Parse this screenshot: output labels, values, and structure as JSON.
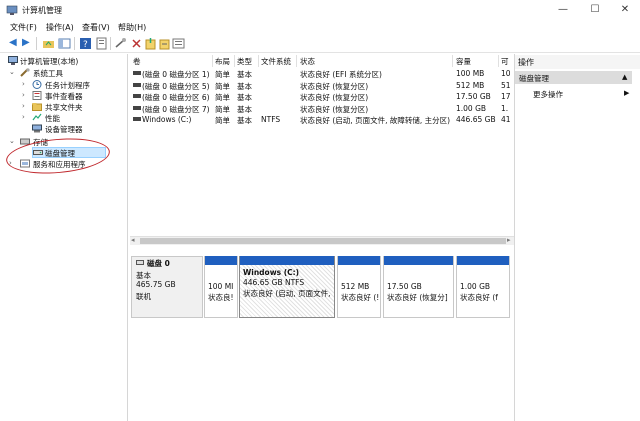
{
  "window": {
    "title": "计算机管理",
    "minimize": "—",
    "maximize": "☐",
    "close": "✕"
  },
  "menu": [
    "文件(F)",
    "操作(A)",
    "查看(V)",
    "帮助(H)"
  ],
  "toolbar": {
    "back": "◀",
    "forward": "▶"
  },
  "tree": {
    "root": "计算机管理(本地)",
    "system_tools": "系统工具",
    "task_scheduler": "任务计划程序",
    "event_viewer": "事件查看器",
    "shared_folders": "共享文件夹",
    "performance": "性能",
    "device_manager": "设备管理器",
    "storage": "存储",
    "disk_management": "磁盘管理",
    "services_apps": "服务和应用程序"
  },
  "volume_list": {
    "columns": [
      "卷",
      "布局",
      "类型",
      "文件系统",
      "状态",
      "容量",
      "可"
    ],
    "rows": [
      {
        "volume": "(磁盘 0 磁盘分区 1)",
        "layout": "简单",
        "type": "基本",
        "fs": "",
        "status": "状态良好 (EFI 系统分区)",
        "capacity": "100 MB",
        "free": "10"
      },
      {
        "volume": "(磁盘 0 磁盘分区 5)",
        "layout": "简单",
        "type": "基本",
        "fs": "",
        "status": "状态良好 (恢复分区)",
        "capacity": "512 MB",
        "free": "51"
      },
      {
        "volume": "(磁盘 0 磁盘分区 6)",
        "layout": "简单",
        "type": "基本",
        "fs": "",
        "status": "状态良好 (恢复分区)",
        "capacity": "17.50 GB",
        "free": "17"
      },
      {
        "volume": "(磁盘 0 磁盘分区 7)",
        "layout": "简单",
        "type": "基本",
        "fs": "",
        "status": "状态良好 (恢复分区)",
        "capacity": "1.00 GB",
        "free": "1."
      },
      {
        "volume": "Windows (C:)",
        "layout": "简单",
        "type": "基本",
        "fs": "NTFS",
        "status": "状态良好 (启动, 页面文件, 故障转储, 主分区)",
        "capacity": "446.65 GB",
        "free": "41"
      }
    ]
  },
  "disk": {
    "name": "磁盘 0",
    "type": "基本",
    "size": "465.75 GB",
    "status": "联机",
    "partitions": [
      {
        "title": "",
        "line1": "100 MI",
        "line2": "状态良!"
      },
      {
        "title": "Windows  (C:)",
        "line1": "446.65 GB NTFS",
        "line2": "状态良好 (启动, 页面文件,"
      },
      {
        "title": "",
        "line1": "512 MB",
        "line2": "状态良好 (!"
      },
      {
        "title": "",
        "line1": "17.50 GB",
        "line2": "状态良好 (恢复分]"
      },
      {
        "title": "",
        "line1": "1.00 GB",
        "line2": "状态良好 (f"
      }
    ]
  },
  "actions": {
    "header": "操作",
    "section": "磁盘管理",
    "section_arrow": "▲",
    "more": "更多操作",
    "more_arrow": "▶"
  },
  "colors": {
    "partition_bar": "#1f5fbf",
    "selection": "#cde8ff",
    "annotation": "#c0282d"
  }
}
